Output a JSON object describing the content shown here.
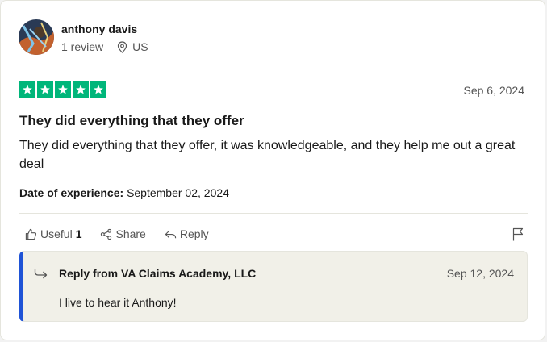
{
  "reviewer": {
    "name": "anthony davis",
    "reviews": "1 review",
    "country": "US"
  },
  "review": {
    "rating": 5,
    "max_rating": 5,
    "date": "Sep 6, 2024",
    "title": "They did everything that they offer",
    "body": "They did everything that they offer, it was knowledgeable, and they help me out a great deal",
    "experience_label": "Date of experience:",
    "experience_date": "September 02, 2024"
  },
  "actions": {
    "useful_label": "Useful",
    "useful_count": "1",
    "share_label": "Share",
    "reply_label": "Reply"
  },
  "reply": {
    "from": "Reply from VA Claims Academy, LLC",
    "date": "Sep 12, 2024",
    "text": "I live to hear it Anthony!"
  },
  "colors": {
    "star_green": "#00b67a",
    "reply_accent": "#1f53d6",
    "reply_bg": "#f1f0e8"
  },
  "icons": [
    "location-pin-icon",
    "star-icon",
    "thumbs-up-icon",
    "share-icon",
    "reply-arrow-icon",
    "flag-icon",
    "reply-indicator-icon"
  ]
}
